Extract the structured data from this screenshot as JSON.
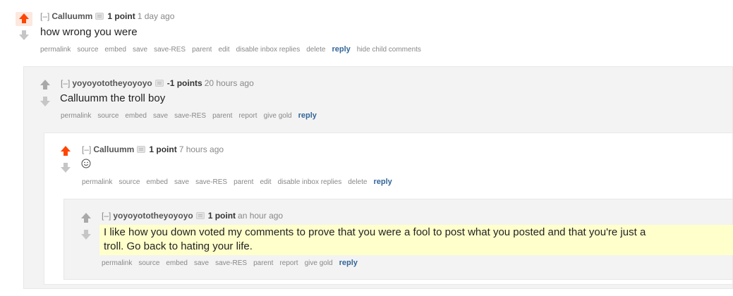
{
  "comments": [
    {
      "collapse": "[–]",
      "author": "Calluumm",
      "score": "1 point",
      "time": "1 day ago",
      "body": "how wrong you were",
      "vote": "up",
      "buttons": [
        "permalink",
        "source",
        "embed",
        "save",
        "save-RES",
        "parent",
        "edit",
        "disable inbox replies",
        "delete"
      ],
      "reply": "reply",
      "extra": "hide child comments"
    },
    {
      "collapse": "[–]",
      "author": "yoyoyototheyoyoyo",
      "score": "-1 points",
      "time": "20 hours ago",
      "body": "Calluumm the troll boy",
      "vote": "none",
      "buttons": [
        "permalink",
        "source",
        "embed",
        "save",
        "save-RES",
        "parent",
        "report",
        "give gold"
      ],
      "reply": "reply"
    },
    {
      "collapse": "[–]",
      "author": "Calluumm",
      "score": "1 point",
      "time": "7 hours ago",
      "body_icon": "smiley-face-icon",
      "vote": "up",
      "buttons": [
        "permalink",
        "source",
        "embed",
        "save",
        "save-RES",
        "parent",
        "edit",
        "disable inbox replies",
        "delete"
      ],
      "reply": "reply"
    },
    {
      "collapse": "[–]",
      "author": "yoyoyototheyoyoyo",
      "score": "1 point",
      "time": "an hour ago",
      "body_line1": "I like how you down voted my comments to prove that you were a fool to post what you posted and that you're just a",
      "body_line2": "troll. Go back to hating your life.",
      "vote": "none",
      "buttons": [
        "permalink",
        "source",
        "embed",
        "save",
        "save-RES",
        "parent",
        "report",
        "give gold"
      ],
      "reply": "reply"
    }
  ],
  "colors": {
    "upvote_active": "#ff4500",
    "arrow_inactive": "#c6c6c6",
    "reply_link": "#336699",
    "highlight": "#ffffcc"
  }
}
